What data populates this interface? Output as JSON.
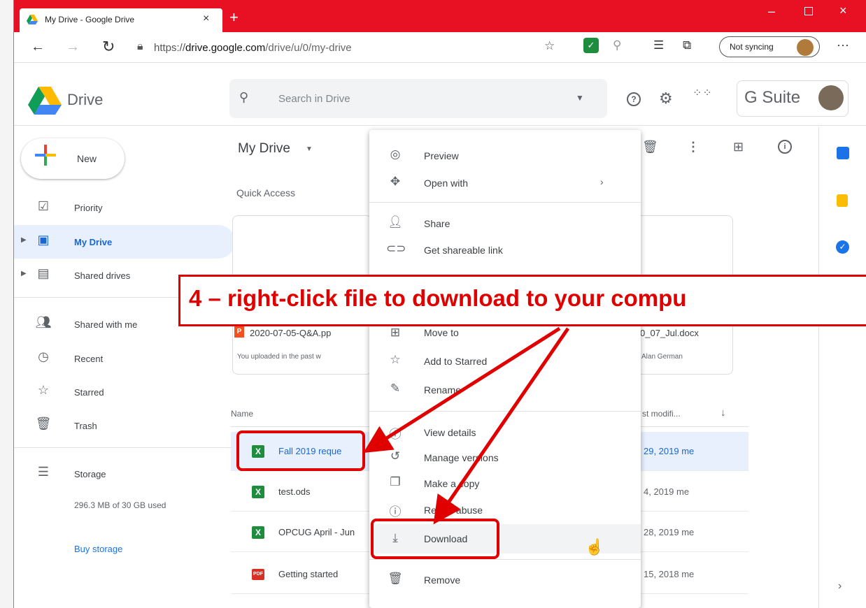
{
  "browser": {
    "tab_title": "My Drive - Google Drive",
    "url_prefix": "https://",
    "url_host": "drive.google.com",
    "url_path": "/drive/u/0/my-drive",
    "sync_label": "Not syncing"
  },
  "header": {
    "app_name": "Drive",
    "search_placeholder": "Search in Drive",
    "gsuite_label": "G Suite"
  },
  "sidebar": {
    "new_label": "New",
    "items": [
      {
        "label": "Priority"
      },
      {
        "label": "My Drive"
      },
      {
        "label": "Shared drives"
      },
      {
        "label": "Shared with me"
      },
      {
        "label": "Recent"
      },
      {
        "label": "Starred"
      },
      {
        "label": "Trash"
      }
    ],
    "storage_label": "Storage",
    "storage_used": "296.3 MB of 30 GB used",
    "buy_storage": "Buy storage"
  },
  "main": {
    "title": "My Drive",
    "quick_access": "Quick Access",
    "cards": [
      {
        "name": "2020-07-05-Q&A.pp",
        "sub": "You uploaded in the past w"
      },
      {
        "name": "0_07_Jul.docx",
        "sub": "Alan German"
      }
    ],
    "col_name": "Name",
    "col_modified": "st modifi...",
    "files": [
      {
        "name": "Fall 2019 reque",
        "date": "29, 2019 me"
      },
      {
        "name": "test.ods",
        "date": "4, 2019 me"
      },
      {
        "name": "OPCUG April - Jun",
        "date": "28, 2019 me"
      },
      {
        "name": "Getting started",
        "date": "15, 2018 me"
      }
    ]
  },
  "context_menu": {
    "preview": "Preview",
    "open_with": "Open with",
    "share": "Share",
    "get_link": "Get shareable link",
    "move_to": "Move to",
    "add_starred": "Add to Starred",
    "rename": "Rename",
    "view_details": "View details",
    "manage_versions": "Manage versions",
    "make_copy": "Make a copy",
    "report_abuse": "Report abuse",
    "download": "Download",
    "remove": "Remove"
  },
  "annotation": {
    "text": "4 – right-click file to download to your compu"
  },
  "colors": {
    "titlebar": "#e81123",
    "accent_blue": "#1967d2",
    "annotation_red": "#e00000",
    "sheets_green": "#1e8e3e"
  }
}
